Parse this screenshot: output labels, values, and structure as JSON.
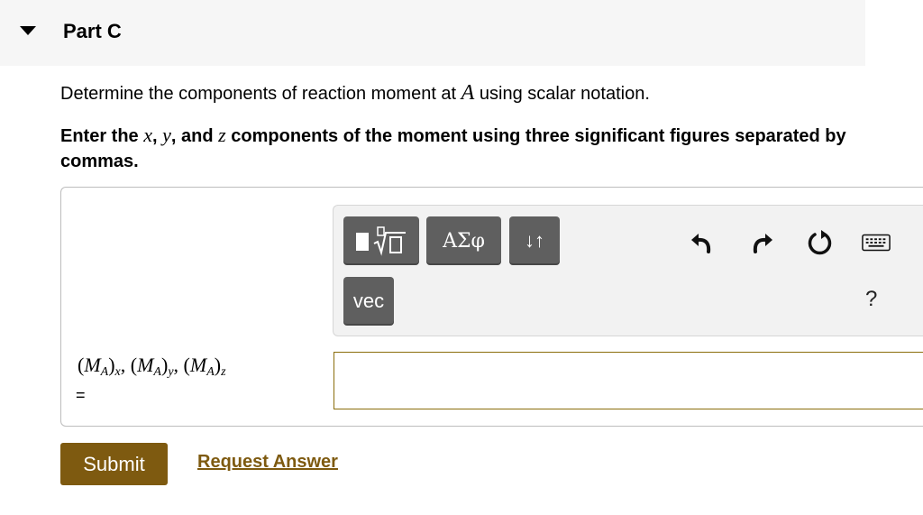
{
  "part": {
    "title": "Part C"
  },
  "prompt": {
    "pre": "Determine the components of reaction moment at ",
    "var": "A",
    "post": " using scalar notation."
  },
  "instructions": {
    "t1": "Enter the ",
    "x": "x",
    "t2": ", ",
    "y": "y",
    "t3": ", and ",
    "z": "z",
    "t4": " components of the moment using three significant figures separated by commas."
  },
  "toolbar": {
    "greek_label": "ΑΣφ",
    "arrows_label": "↓↑",
    "vec_label": "vec",
    "help_label": "?",
    "icons": [
      "templates-icon",
      "undo-icon",
      "redo-icon",
      "reset-icon",
      "keyboard-icon"
    ]
  },
  "answer": {
    "label_open": "(",
    "label_M": "M",
    "label_A": "A",
    "label_x": "x",
    "label_y": "y",
    "label_z": "z",
    "label_close": ")",
    "equals": "=",
    "value": ""
  },
  "actions": {
    "submit_label": "Submit",
    "request_label": "Request Answer"
  },
  "colors": {
    "accent": "#7e5a10",
    "toolbar_button": "#5f5f5f",
    "header_bg": "#f6f6f6"
  }
}
